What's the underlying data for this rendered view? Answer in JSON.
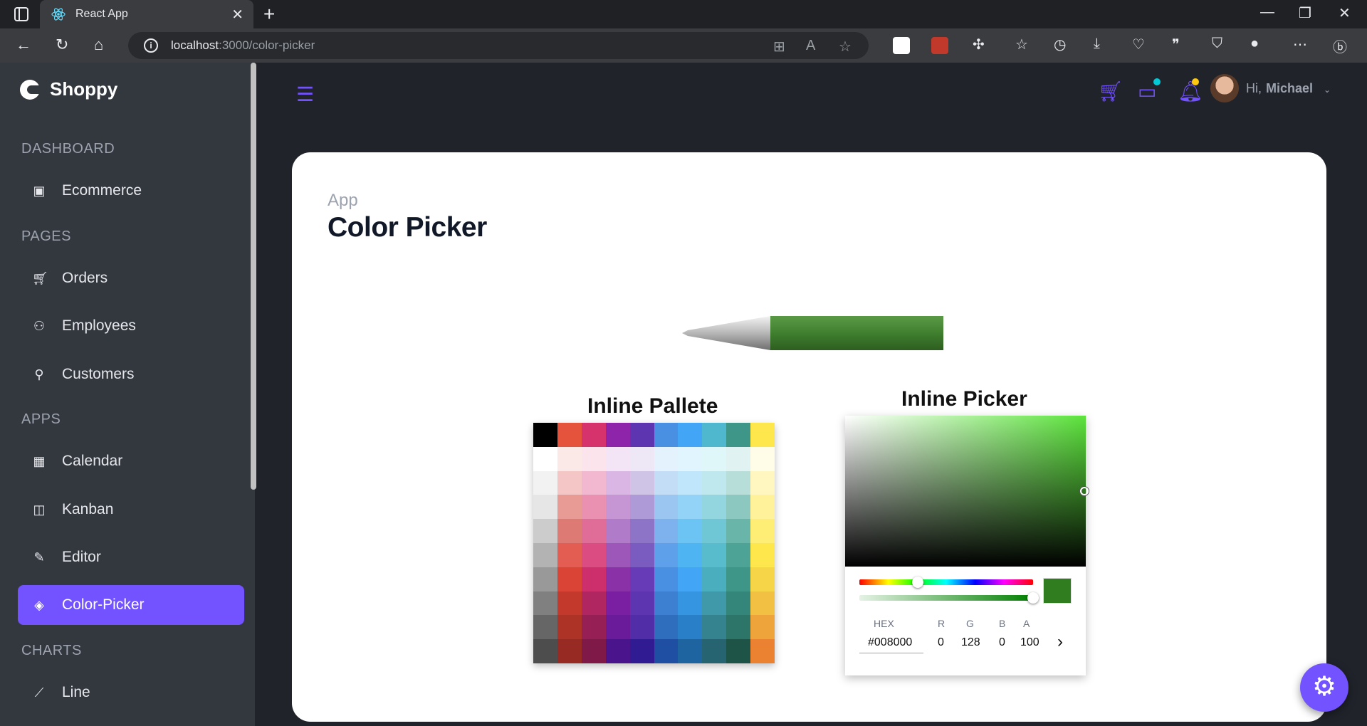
{
  "browser": {
    "tab_title": "React App",
    "url_host": "localhost",
    "url_rest": ":3000/color-picker"
  },
  "sidebar": {
    "brand": "Shoppy",
    "sections": [
      {
        "title": "DASHBOARD",
        "items": [
          {
            "label": "Ecommerce",
            "icon": "shopping-bag-icon"
          }
        ]
      },
      {
        "title": "PAGES",
        "items": [
          {
            "label": "Orders",
            "icon": "cart-icon"
          },
          {
            "label": "Employees",
            "icon": "users-icon"
          },
          {
            "label": "Customers",
            "icon": "customer-icon"
          }
        ]
      },
      {
        "title": "APPS",
        "items": [
          {
            "label": "Calendar",
            "icon": "calendar-icon"
          },
          {
            "label": "Kanban",
            "icon": "kanban-icon"
          },
          {
            "label": "Editor",
            "icon": "edit-icon"
          },
          {
            "label": "Color-Picker",
            "icon": "paint-bucket-icon",
            "active": true
          }
        ]
      },
      {
        "title": "CHARTS",
        "items": [
          {
            "label": "Line",
            "icon": "line-chart-icon"
          }
        ]
      }
    ]
  },
  "header": {
    "greeting": "Hi,",
    "user": "Michael"
  },
  "main": {
    "breadcrumb": "App",
    "title": "Color Picker",
    "palette_title": "Inline Pallete",
    "picker_title": "Inline Picker"
  },
  "picker": {
    "hex_label": "HEX",
    "hex_value": "#008000",
    "r_label": "R",
    "r_value": "0",
    "g_label": "G",
    "g_value": "128",
    "b_label": "B",
    "b_value": "0",
    "a_label": "A",
    "a_value": "100",
    "current_color": "#008000"
  },
  "colors": {
    "accent": "#7352ff",
    "sidebar_bg": "#33373e",
    "page_bg": "#20232a"
  }
}
